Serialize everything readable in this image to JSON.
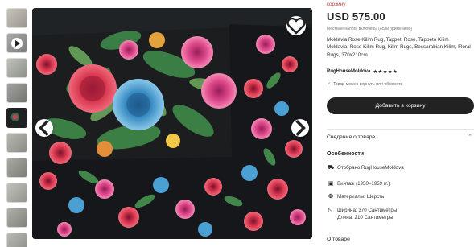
{
  "gallery": {
    "thumb_colors": [
      "#b5b0a8",
      "#9a9a9a",
      "#a7a9a4",
      "#8e8f8a",
      "#2a2b2d",
      "#a4a6a0",
      "#8f9189",
      "#b1b3ac",
      "#9c9e96",
      "#a9aba4"
    ]
  },
  "listing": {
    "cart_link": "корзину",
    "price": "USD 575.00",
    "price_note": "Местные налоги включены (если применимо)",
    "title": "Moldavia Rose Kilim Rug, Tappeti Rose, Tappeto Kilim Moldavia, Rose Kilim Rug, Kilim Rugs, Bessarabian Kilim, Floral Rugs, 370x210cm",
    "shop_name": "RugHouseMoldova",
    "rating_stars": "★★★★★",
    "returns_note": "Товар можно вернуть или обменять",
    "cart_button": "Добавить в корзину",
    "details_label": "Сведения о товаре",
    "features_label": "Особенности",
    "features": [
      {
        "icon": "truck-icon",
        "glyph": "⛟",
        "lines": [
          "Отобрано RugHouseMoldova"
        ]
      },
      {
        "icon": "calendar-icon",
        "glyph": "▣",
        "lines": [
          "Винтаж (1950–1959 гг.)"
        ]
      },
      {
        "icon": "materials-icon",
        "glyph": "❂",
        "lines": [
          "Материалы: Шерсть"
        ]
      },
      {
        "icon": "ruler-icon",
        "glyph": "◺",
        "lines": [
          "Ширина: 370 Сантиметры",
          "Длина: 210 Сантиметры"
        ]
      }
    ],
    "about_label": "О товаре"
  }
}
